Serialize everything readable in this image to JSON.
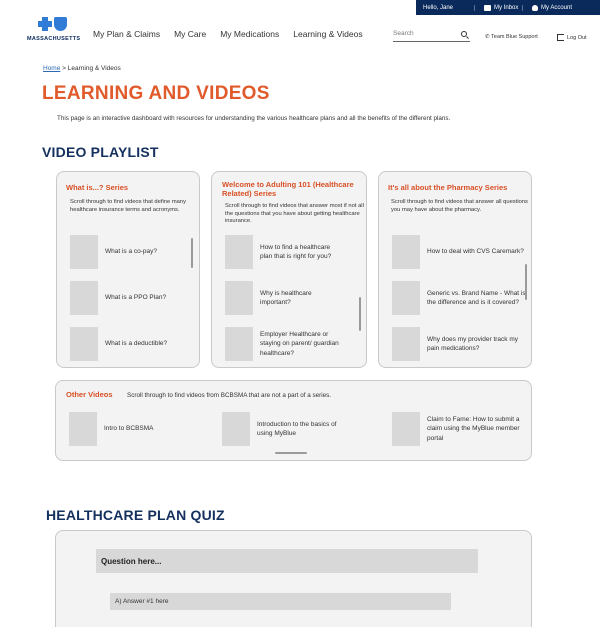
{
  "utility": {
    "hello": "Hello, Jane",
    "inbox": "My Inbox",
    "account": "My Account",
    "bg_color": "#0b2a5c"
  },
  "logo": {
    "text": "MASSACHUSETTS"
  },
  "nav": {
    "items": [
      "My Plan & Claims",
      "My Care",
      "My Medications",
      "Learning & Videos"
    ],
    "search_placeholder": "Search",
    "support": "Team Blue Support",
    "logout": "Log Out"
  },
  "breadcrumb": {
    "home": "Home",
    "sep": ">",
    "current": "Learning & Videos"
  },
  "page": {
    "title": "LEARNING AND VIDEOS",
    "intro": "This page is an interactive dashboard with resources for understanding the various healthcare plans and all the benefits of the different plans.",
    "accent_color": "#e15a2b"
  },
  "playlist": {
    "title": "VIDEO PLAYLIST",
    "series": [
      {
        "title": "What is...? Series",
        "desc": "Scroll through to find videos that define many healthcare insurance terms and acronyms.",
        "videos": [
          "What is a co-pay?",
          "What is a PPO Plan?",
          "What is a deductible?"
        ]
      },
      {
        "title": "Welcome to Adulting 101 (Healthcare Related) Series",
        "desc": "Scroll through to find videos that answer most if not all the questions that you have about getting healthcare insurance.",
        "videos": [
          "How to find a healthcare plan that is right for you?",
          "Why is healthcare important?",
          "Employer Healthcare or staying on parent/ guardian healthcare?"
        ]
      },
      {
        "title": "It's all about the Pharmacy Series",
        "desc": "Scroll through to find videos that answer all questions you may have about the pharmacy.",
        "videos": [
          "How to deal with CVS Caremark?",
          "Generic vs. Brand Name - What is the difference and is it covered?",
          "Why does my provider track my pain medications?"
        ]
      }
    ],
    "other": {
      "title": "Other Videos",
      "desc": "Scroll through to find videos from BCBSMA that are not a part of a series.",
      "videos": [
        "Intro to BCBSMA",
        "Introduction to the basics of using MyBlue",
        "Claim to Fame: How to submit a claim using the MyBlue member portal"
      ]
    }
  },
  "quiz": {
    "title": "HEALTHCARE PLAN QUIZ",
    "question": "Question here...",
    "answer1": "A) Answer #1 here"
  }
}
